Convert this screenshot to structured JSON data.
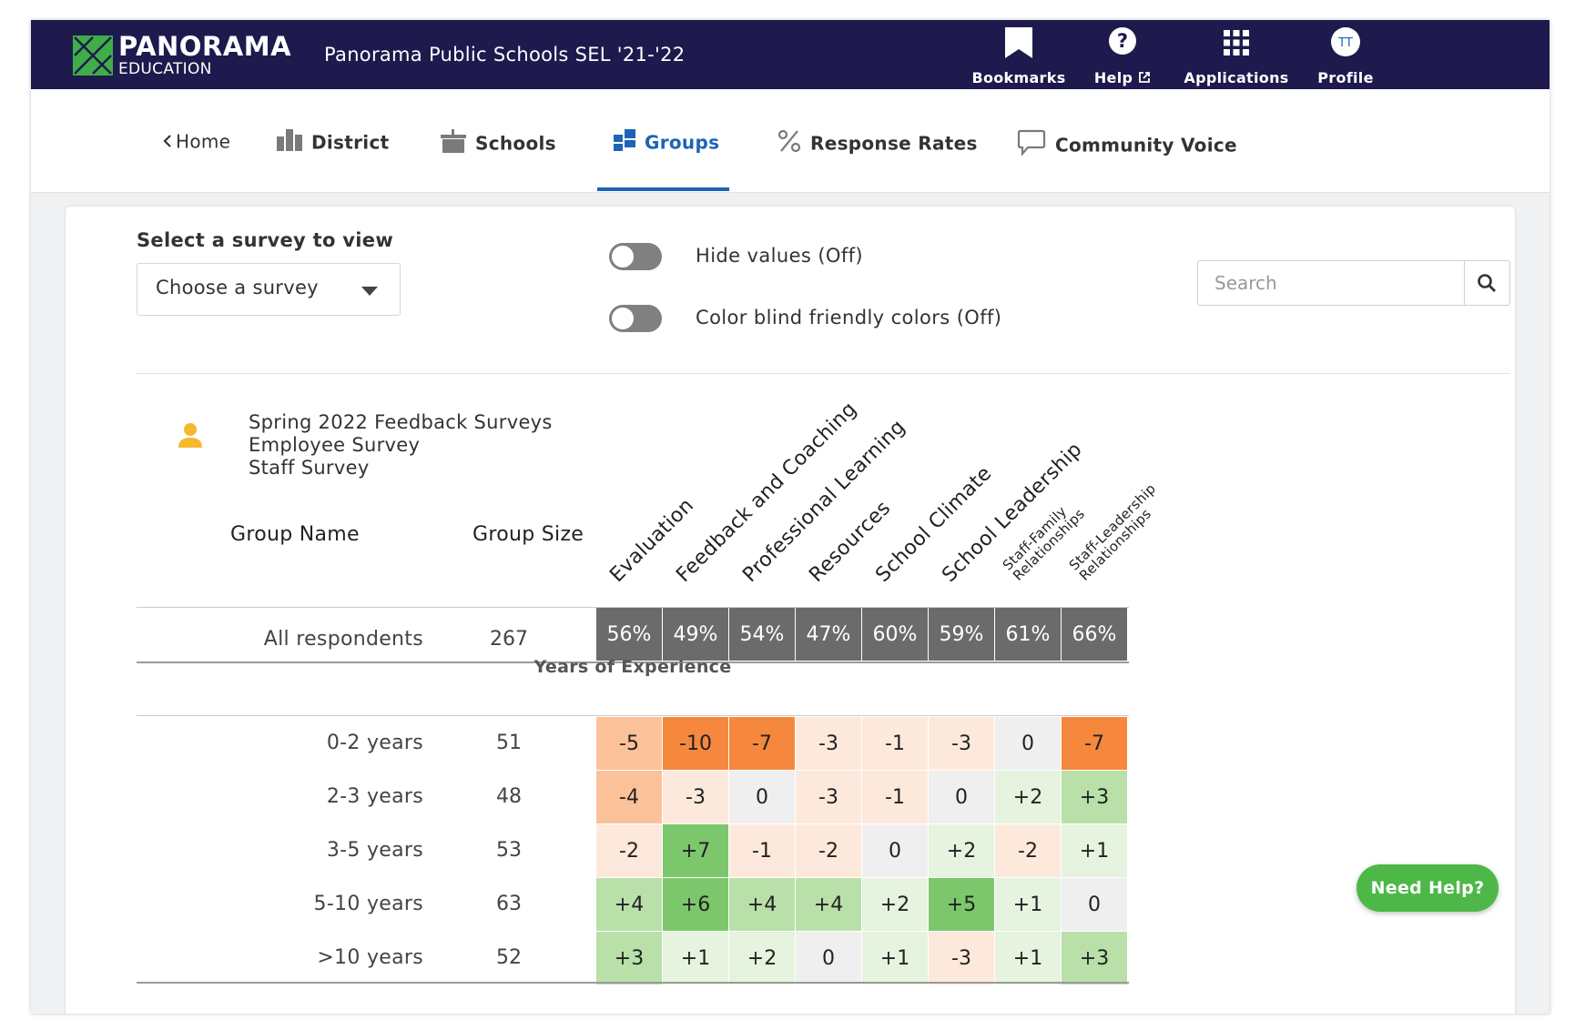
{
  "brand": {
    "name": "PANORAMA",
    "sub": "EDUCATION"
  },
  "app_title": "Panorama Public Schools SEL '21-'22",
  "topnav": {
    "bookmarks": "Bookmarks",
    "help": "Help",
    "applications": "Applications",
    "profile": "Profile",
    "profile_initials": "TT"
  },
  "tabs": [
    {
      "label": "Home",
      "icon": "chevron-left-icon"
    },
    {
      "label": "District",
      "icon": "district-icon"
    },
    {
      "label": "Schools",
      "icon": "school-icon"
    },
    {
      "label": "Groups",
      "icon": "groups-icon",
      "active": true
    },
    {
      "label": "Response Rates",
      "icon": "percent-icon"
    },
    {
      "label": "Community Voice",
      "icon": "speech-bubble-icon"
    }
  ],
  "controls": {
    "survey_label": "Select a survey to view",
    "survey_select_value": "Choose a survey",
    "hide_values_label": "Hide values (Off)",
    "color_blind_label": "Color blind friendly colors (Off)",
    "search_placeholder": "Search"
  },
  "survey_info": {
    "lines": [
      "Spring 2022 Feedback Surveys",
      "Employee Survey",
      "Staff Survey"
    ]
  },
  "table": {
    "group_name_header": "Group Name",
    "group_size_header": "Group Size",
    "columns": [
      "Evaluation",
      "Feedback and Coaching",
      "Professional Learning",
      "Resources",
      "School Climate",
      "School Leadership",
      "Staff-Family Relationships",
      "Staff-Leadership Relationships"
    ],
    "all_row": {
      "label": "All respondents",
      "size": "267",
      "values": [
        "56%",
        "49%",
        "54%",
        "47%",
        "60%",
        "59%",
        "61%",
        "66%"
      ]
    },
    "section_title": "Years of Experience",
    "rows": [
      {
        "label": "0-2 years",
        "size": "51",
        "values": [
          "-5",
          "-10",
          "-7",
          "-3",
          "-1",
          "-3",
          "0",
          "-7"
        ]
      },
      {
        "label": "2-3 years",
        "size": "48",
        "values": [
          "-4",
          "-3",
          "0",
          "-3",
          "-1",
          "0",
          "+2",
          "+3"
        ]
      },
      {
        "label": "3-5 years",
        "size": "53",
        "values": [
          "-2",
          "+7",
          "-1",
          "-2",
          "0",
          "+2",
          "-2",
          "+1"
        ]
      },
      {
        "label": "5-10 years",
        "size": "63",
        "values": [
          "+4",
          "+6",
          "+4",
          "+4",
          "+2",
          "+5",
          "+1",
          "0"
        ]
      },
      {
        "label": ">10 years",
        "size": "52",
        "values": [
          "+3",
          "+1",
          "+2",
          "0",
          "+1",
          "-3",
          "+1",
          "+3"
        ]
      }
    ]
  },
  "colors": {
    "neg_strong": "#f5883d",
    "neg_medium": "#fbc29a",
    "neg_light": "#fde9dc",
    "neutral": "#efefef",
    "pos_light": "#e5f3df",
    "pos_medium": "#b9e0a9",
    "pos_strong": "#7cc76b",
    "total_bg": "#6b6b6b",
    "brand_navy": "#1e1a4d",
    "accent_blue": "#1e63b5",
    "help_green": "#4db848"
  },
  "need_help": "Need Help?"
}
